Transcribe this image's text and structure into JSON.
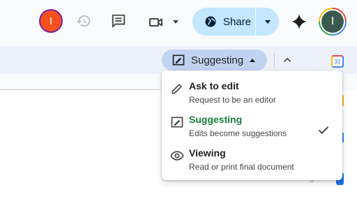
{
  "header": {
    "presence_avatar_initial": "I",
    "share": {
      "label": "Share"
    },
    "account_initial": "I"
  },
  "toolbar": {
    "mode_chip_label": "Suggesting"
  },
  "mode_menu": {
    "items": [
      {
        "title": "Ask to edit",
        "description": "Request to be an editor",
        "icon": "pencil-icon",
        "selected": false
      },
      {
        "title": "Suggesting",
        "description": "Edits become suggestions",
        "icon": "suggest-edit-icon",
        "selected": true
      },
      {
        "title": "Viewing",
        "description": "Read or print final document",
        "icon": "eye-icon",
        "selected": false
      }
    ],
    "selected_color": "#188038"
  },
  "side_panel": {
    "calendar_icon_text": "31"
  },
  "colors": {
    "share_button_bg": "#c2e7ff",
    "mode_chip_bg": "#c2d3f2",
    "toolbar_bg": "#edf2fa",
    "presence_avatar_bg": "#f4511e"
  }
}
